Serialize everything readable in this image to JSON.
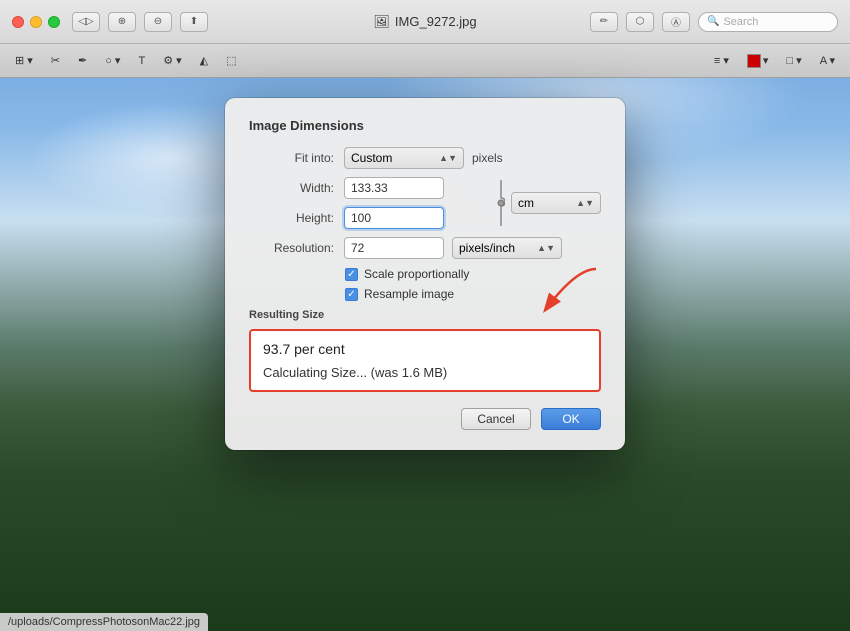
{
  "window": {
    "title": "IMG_9272.jpg",
    "title_icon": "🖼"
  },
  "titlebar": {
    "search_placeholder": "Search"
  },
  "dialog": {
    "title": "Image Dimensions",
    "fit_into_label": "Fit into:",
    "fit_into_value": "Custom",
    "fit_into_unit": "pixels",
    "width_label": "Width:",
    "width_value": "133.33",
    "height_label": "Height:",
    "height_value": "100",
    "unit_value": "cm",
    "resolution_label": "Resolution:",
    "resolution_value": "72",
    "resolution_unit": "pixels/inch",
    "scale_label": "Scale proportionally",
    "resample_label": "Resample image",
    "resulting_size_label": "Resulting Size",
    "resulting_percent": "93.7 per cent",
    "resulting_calc": "Calculating Size... (was 1.6 MB)",
    "cancel_label": "Cancel",
    "ok_label": "OK"
  },
  "url_bar": {
    "text": "/uploads/CompressPhotosonMac22.jpg"
  }
}
